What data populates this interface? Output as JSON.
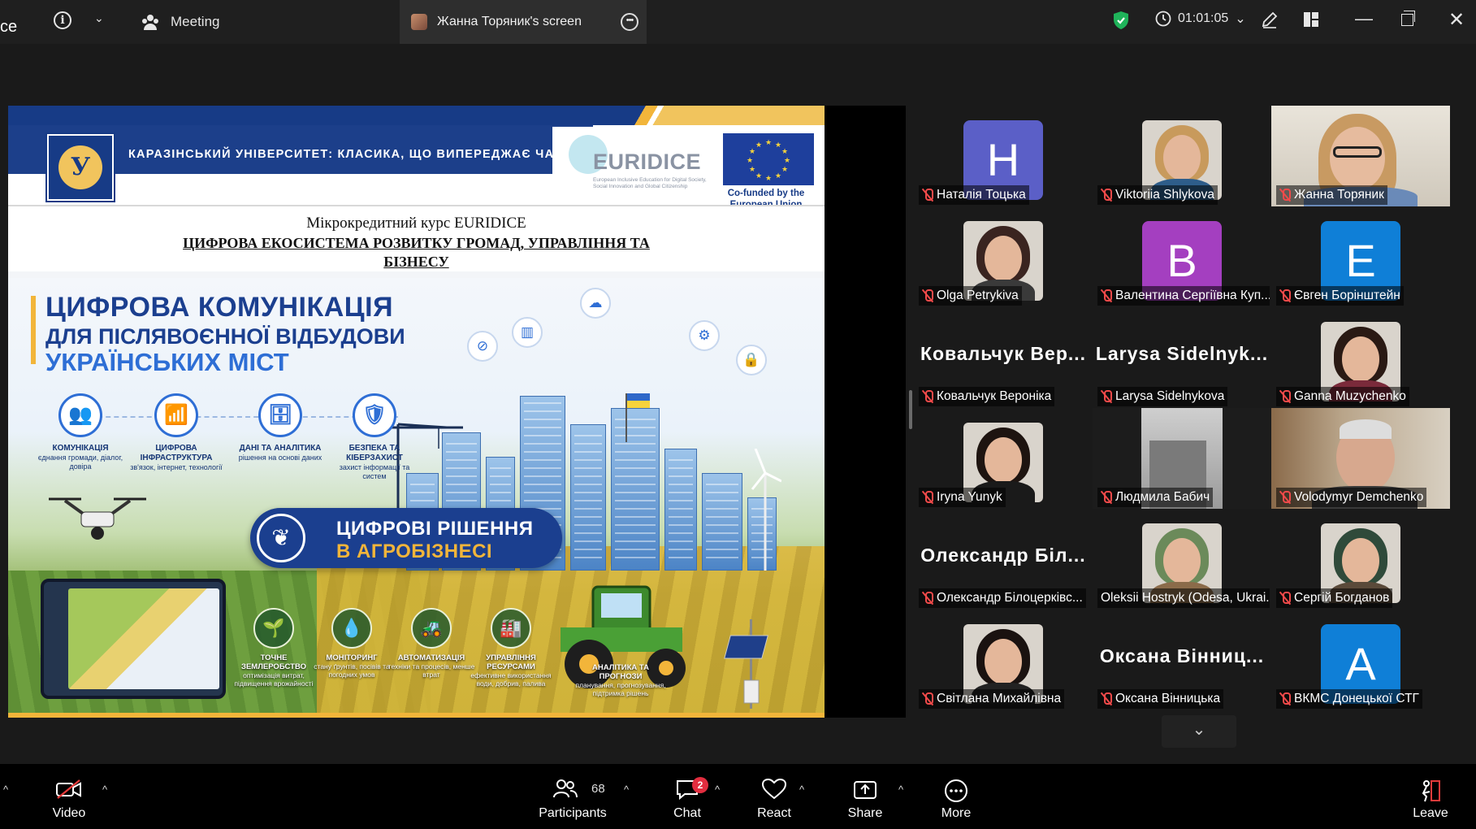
{
  "titlebar": {
    "app_name_cut": "ce",
    "meeting_tab": "Meeting",
    "screen_tab": "Жанна Торяник's screen",
    "timer": "01:01:05"
  },
  "slide": {
    "uni_logo_letter": "У",
    "uni_motto": "КАРАЗІНСЬКИЙ УНІВЕРСИТЕТ: КЛАСИКА, ЩО ВИПЕРЕДЖАЄ ЧАС",
    "euridice_title": "EURIDICE",
    "euridice_sub": "European Inclusive Education for Digital Society, Social Innovation and Global Citizenship",
    "eu_text": "Co-funded by the European Union",
    "course_line1": "Мікрокредитний курс EURIDICE",
    "course_line2": "ЦИФРОВА ЕКОСИСТЕМА РОЗВИТКУ ГРОМАД, УПРАВЛІННЯ ТА БІЗНЕСУ",
    "title1": "ЦИФРОВА КОМУНІКАЦІЯ",
    "title2": "ДЛЯ ПІСЛЯВОЄННОЇ ВІДБУДОВИ",
    "title3": "УКРАЇНСЬКИХ МІСТ",
    "pillars": [
      {
        "icon": "👥",
        "title": "КОМУНІКАЦІЯ",
        "desc": "єднання громади, діалог, довіра"
      },
      {
        "icon": "📶",
        "title": "ЦИФРОВА ІНФРАСТРУКТУРА",
        "desc": "зв'язок, інтернет, технології"
      },
      {
        "icon": "🗄",
        "title": "ДАНІ ТА АНАЛІТИКА",
        "desc": "рішення на основі даних"
      },
      {
        "icon": "🛡",
        "title": "БЕЗПЕКА ТА КІБЕРЗАХИСТ",
        "desc": "захист інформації та систем"
      }
    ],
    "agro_t1": "ЦИФРОВІ РІШЕННЯ",
    "agro_t2": "В АГРОБІЗНЕСІ",
    "agro_items": [
      {
        "icon": "🌱",
        "title": "ТОЧНЕ ЗЕМЛЕРОБСТВО",
        "desc": "оптимізація витрат, підвищення врожайності"
      },
      {
        "icon": "💧",
        "title": "МОНІТОРИНГ",
        "desc": "стану ґрунтів, посівів та погодних умов"
      },
      {
        "icon": "🚜",
        "title": "АВТОМАТИЗАЦІЯ",
        "desc": "техніки та процесів, менше втрат"
      },
      {
        "icon": "🏭",
        "title": "УПРАВЛІННЯ РЕСУРСАМИ",
        "desc": "ефективне використання води, добрив, палива"
      },
      {
        "icon": "",
        "title": "АНАЛІТИКА ТА ПРОГНОЗИ",
        "desc": "планування, прогнозування, підтримка рішень"
      }
    ]
  },
  "participants": [
    {
      "name": "Наталія Тоцька",
      "type": "avatar",
      "letter": "H",
      "color": "#5b5fc7"
    },
    {
      "name": "Viktoriia Shlykova",
      "type": "photo",
      "hair": "#c89a5c",
      "body": "#2e5d8a"
    },
    {
      "name": "Жанна Торяник",
      "type": "video",
      "active": true
    },
    {
      "name": "Olga Petrykiva",
      "type": "photo",
      "hair": "#3a2420",
      "body": "#3a3a3a"
    },
    {
      "name": "Валентина Сергіївна Куп...",
      "type": "avatar",
      "letter": "B",
      "color": "#a43fc0"
    },
    {
      "name": "Євген Борінштейн",
      "type": "avatar",
      "letter": "E",
      "color": "#0f7fd7"
    },
    {
      "name": "Ковальчук Вероніка",
      "type": "bigname",
      "bigname": "Ковальчук Вер..."
    },
    {
      "name": "Larysa Sidelnykova",
      "type": "bigname",
      "bigname": "Larysa Sidelnyk..."
    },
    {
      "name": "Ganna Muzychenko",
      "type": "photo",
      "hair": "#2a1a14",
      "body": "#7a2a3a"
    },
    {
      "name": "Iryna Yunyk",
      "type": "photo",
      "hair": "#1e1410",
      "body": "#1a1a1a"
    },
    {
      "name": "Людмила Бабич",
      "type": "video2"
    },
    {
      "name": "Volodymyr Demchenko",
      "type": "video3"
    },
    {
      "name": "Олександр Білоцерківс...",
      "type": "bigname",
      "bigname": "Олександр Біл..."
    },
    {
      "name": "Oleksii Hostryk (Odesa, Ukrai...",
      "type": "photo",
      "hair": "#6b8a5a",
      "body": "#8b6b4a",
      "nomic": true
    },
    {
      "name": "Сергій Богданов",
      "type": "photo",
      "hair": "#2f4a3a",
      "body": "#5a4a3a"
    },
    {
      "name": "Світлана Михайлівна",
      "type": "photo",
      "hair": "#1a1210",
      "body": "#222"
    },
    {
      "name": "Оксана Вінницька",
      "type": "bigname",
      "bigname": "Оксана Вінниц..."
    },
    {
      "name": "ВКМС Донецької СТГ",
      "type": "avatar",
      "letter": "A",
      "color": "#0f7fd7"
    }
  ],
  "toolbar": {
    "video": "Video",
    "participants": "Participants",
    "participants_count": "68",
    "chat": "Chat",
    "chat_badge": "2",
    "react": "React",
    "share": "Share",
    "more": "More",
    "leave": "Leave"
  }
}
